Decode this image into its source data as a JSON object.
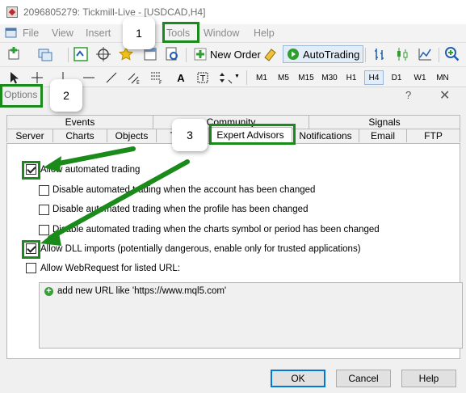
{
  "window": {
    "title": "2096805279: Tickmill-Live - [USDCAD,H4]"
  },
  "menu": [
    "File",
    "View",
    "Insert",
    "Tools",
    "Window",
    "Help"
  ],
  "toolbar": {
    "new_order": "New Order",
    "autotrading": "AutoTrading",
    "timeframes": [
      "M1",
      "M5",
      "M15",
      "M30",
      "H1",
      "H4",
      "D1",
      "W1",
      "MN"
    ],
    "selected_timeframe": "H4"
  },
  "dialog": {
    "title": "Options",
    "help": "?",
    "close": "✕",
    "tabs_row1": [
      "Events",
      "Community",
      "Signals"
    ],
    "tabs_row2": [
      "Server",
      "Charts",
      "Objects",
      "Trade",
      "Expert Advisors",
      "Notifications",
      "Email",
      "FTP"
    ],
    "active_tab": "Expert Advisors",
    "options": [
      {
        "label": "Allow automated trading",
        "checked": true
      },
      {
        "label": "Disable automated trading when the account has been changed",
        "checked": false
      },
      {
        "label": "Disable automated trading when the profile has been changed",
        "checked": false
      },
      {
        "label": "Disable automated trading when the charts symbol or period has been changed",
        "checked": false
      },
      {
        "label": "Allow DLL imports (potentially dangerous, enable only for trusted applications)",
        "checked": true
      },
      {
        "label": "Allow WebRequest for listed URL:",
        "checked": false
      }
    ],
    "url_placeholder": "add new URL like 'https://www.mql5.com'",
    "buttons": {
      "ok": "OK",
      "cancel": "Cancel",
      "help": "Help"
    }
  },
  "annotations": {
    "step1": "1",
    "step2": "2",
    "step3": "3"
  },
  "colors": {
    "annotation_green": "#1a8a1a",
    "focus_blue": "#0078d7"
  }
}
